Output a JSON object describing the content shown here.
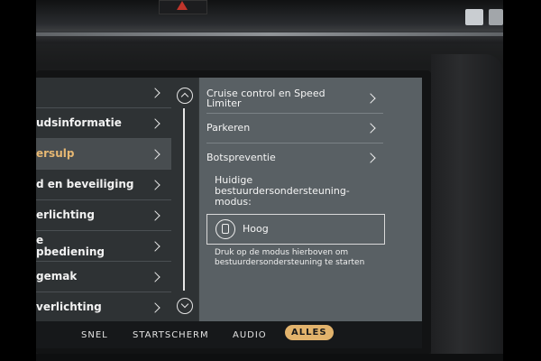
{
  "menu": {
    "items": [
      {
        "label": ""
      },
      {
        "label": "udsinformatie"
      },
      {
        "label": "ersulp"
      },
      {
        "label": "d en beveiliging"
      },
      {
        "label": "erlichting"
      },
      {
        "label": "e\npbediening"
      },
      {
        "label": "gemak"
      },
      {
        "label": "verlichting"
      }
    ]
  },
  "detail": {
    "items": [
      {
        "label": "Cruise control en Speed Limiter"
      },
      {
        "label": "Parkeren"
      },
      {
        "label": "Botspreventie"
      }
    ],
    "mode_heading": "Huidige bestuurdersondersteuning-modus:",
    "mode_value": "Hoog",
    "mode_description": "Druk op de modus hierboven om bestuurdersondersteuning te starten"
  },
  "tabs": [
    {
      "label": "SNEL"
    },
    {
      "label": "STARTSCHERM"
    },
    {
      "label": "AUDIO"
    },
    {
      "label": "ALLES"
    }
  ],
  "colors": {
    "accent": "#e2b36c",
    "selected_text": "#e7b873",
    "hazard": "#c0352b"
  }
}
